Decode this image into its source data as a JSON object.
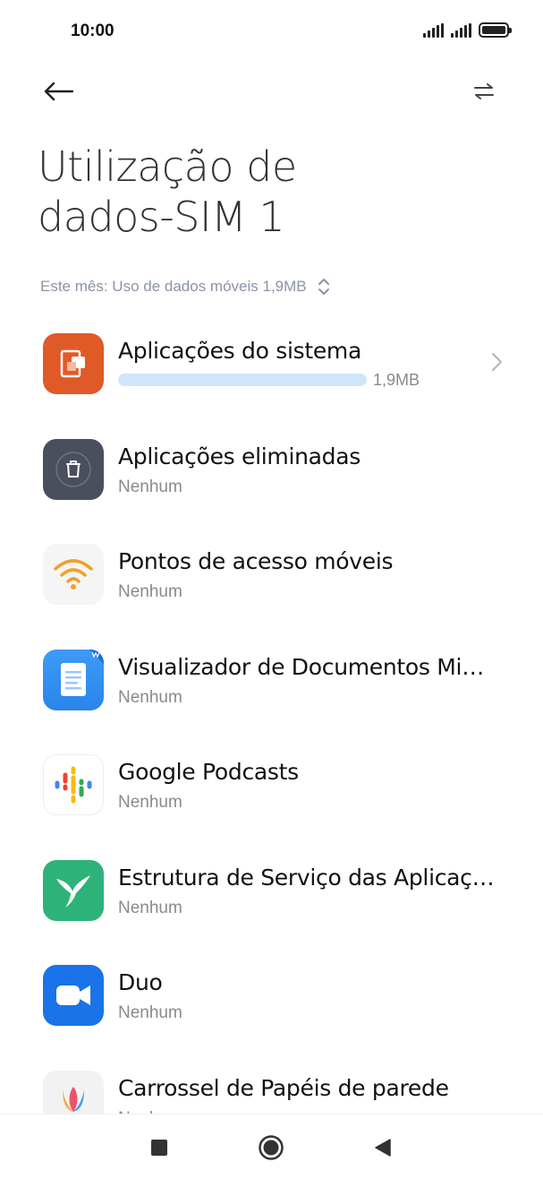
{
  "status_bar": {
    "time": "10:00",
    "icons": [
      "signal-icon",
      "signal-icon",
      "battery-icon"
    ]
  },
  "toolbar": {
    "back_icon": "arrow-left-icon",
    "switch_icon": "swap-arrows-icon"
  },
  "page": {
    "title_line1": "Utilização de",
    "title_line2": "dados-SIM 1"
  },
  "summary": {
    "text": "Este mês: Uso de dados móveis 1,9MB",
    "icon": "sort-updown-icon"
  },
  "apps": [
    {
      "name": "Aplicações do sistema",
      "usage": "1,9MB",
      "usage_fraction": 1.0,
      "icon": "system-apps-icon",
      "icon_color": "#E05A28"
    },
    {
      "name": "Aplicações eliminadas",
      "sub": "Nenhum",
      "icon": "trash-icon",
      "icon_color": "#4A4F5C"
    },
    {
      "name": "Pontos de acesso móveis",
      "sub": "Nenhum",
      "icon": "wifi-hotspot-icon",
      "icon_color": "#F1A02C"
    },
    {
      "name": "Visualizador de Documentos Mi…",
      "sub": "Nenhum",
      "icon": "document-viewer-icon",
      "icon_color": "#2F8CF0"
    },
    {
      "name": "Google Podcasts",
      "sub": "Nenhum",
      "icon": "podcasts-icon",
      "icon_color": "#FFFFFF"
    },
    {
      "name": "Estrutura de Serviço das Aplicaç…",
      "sub": "Nenhum",
      "icon": "hummingbird-icon",
      "icon_color": "#2DB37A"
    },
    {
      "name": "Duo",
      "sub": "Nenhum",
      "icon": "video-camera-icon",
      "icon_color": "#1A73E8"
    },
    {
      "name": "Carrossel de Papéis de parede",
      "sub": "Nenhum",
      "icon": "tulip-icon",
      "icon_color": "#F2F2F2"
    }
  ],
  "nav_bar": {
    "recents_icon": "square-icon",
    "home_icon": "circle-icon",
    "back_icon": "triangle-back-icon"
  }
}
